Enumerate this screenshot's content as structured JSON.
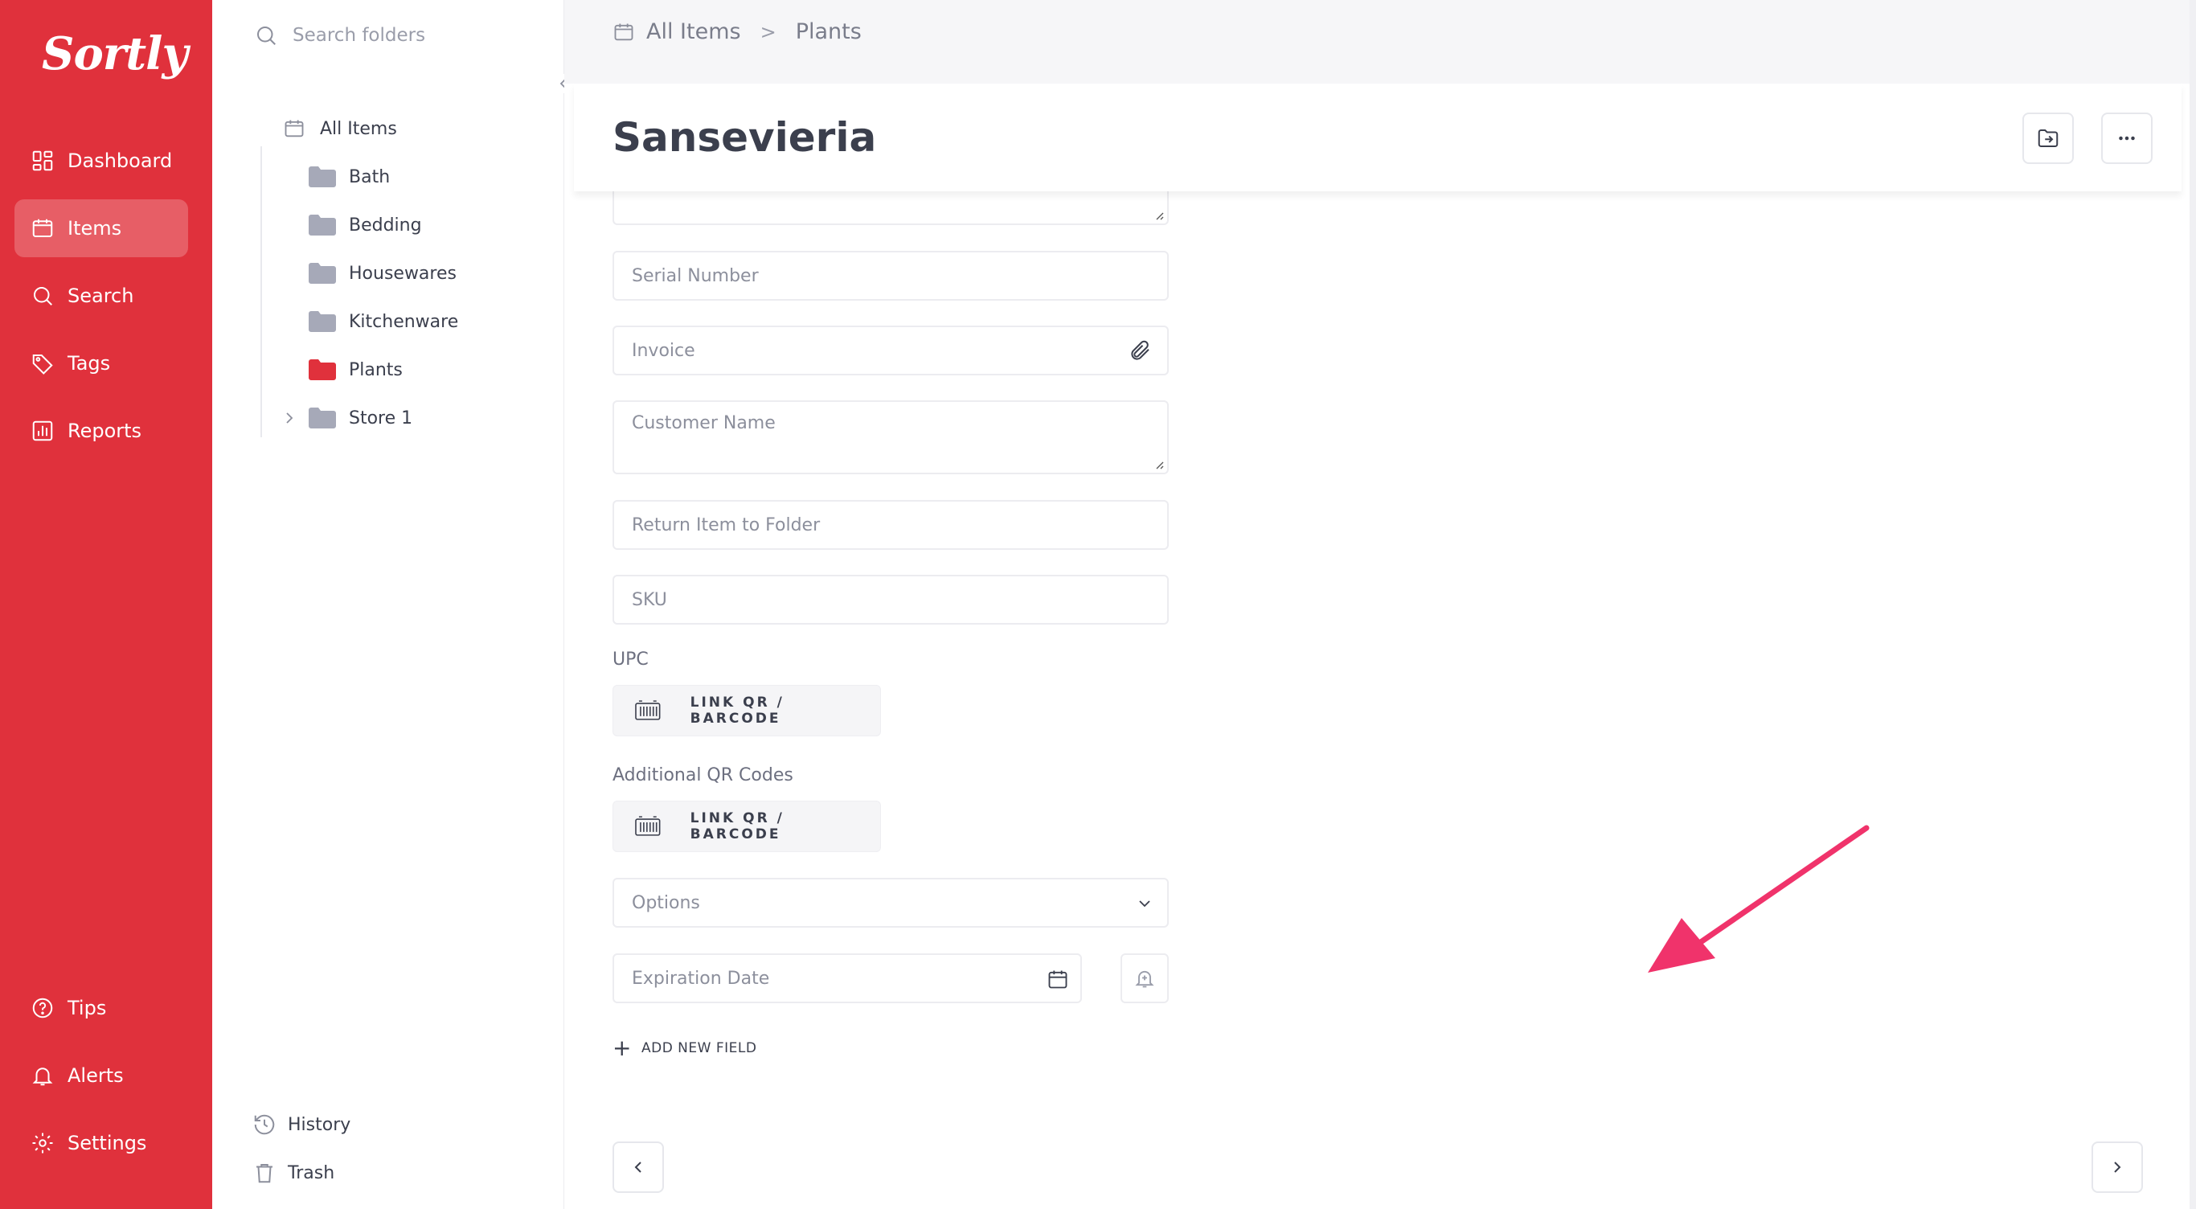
{
  "app": {
    "logo_text": "Sortly",
    "brand_color": "#e0313c"
  },
  "nav": {
    "items": [
      {
        "label": "Dashboard",
        "icon": "dashboard-icon"
      },
      {
        "label": "Items",
        "icon": "items-icon",
        "active": true
      },
      {
        "label": "Search",
        "icon": "search-icon"
      },
      {
        "label": "Tags",
        "icon": "tag-icon"
      },
      {
        "label": "Reports",
        "icon": "reports-icon"
      }
    ],
    "bottom": [
      {
        "label": "Tips",
        "icon": "help-icon"
      },
      {
        "label": "Alerts",
        "icon": "bell-icon"
      },
      {
        "label": "Settings",
        "icon": "gear-icon"
      }
    ]
  },
  "folders": {
    "search_placeholder": "Search folders",
    "root": "All Items",
    "items": [
      {
        "label": "Bath",
        "color": "#a6a9b8"
      },
      {
        "label": "Bedding",
        "color": "#a6a9b8"
      },
      {
        "label": "Housewares",
        "color": "#a6a9b8"
      },
      {
        "label": "Kitchenware",
        "color": "#a6a9b8"
      },
      {
        "label": "Plants",
        "color": "#e0313c",
        "selected": true
      },
      {
        "label": "Store 1",
        "color": "#a6a9b8",
        "expandable": true
      }
    ],
    "history": "History",
    "trash": "Trash"
  },
  "breadcrumb": {
    "root": "All Items",
    "separator": ">",
    "current": "Plants"
  },
  "item": {
    "title": "Sansevieria"
  },
  "fields": {
    "serial_number": "Serial Number",
    "invoice": "Invoice",
    "customer_name": "Customer Name",
    "return_item": "Return Item to Folder",
    "sku": "SKU",
    "upc_label": "UPC",
    "upc_button": "LINK QR / BARCODE",
    "additional_qr_label": "Additional QR Codes",
    "additional_qr_button": "LINK QR / BARCODE",
    "options": "Options",
    "expiration_date": "Expiration Date",
    "add_new_field": "ADD NEW FIELD"
  },
  "annotation": {
    "arrow_color": "#f0336b"
  }
}
